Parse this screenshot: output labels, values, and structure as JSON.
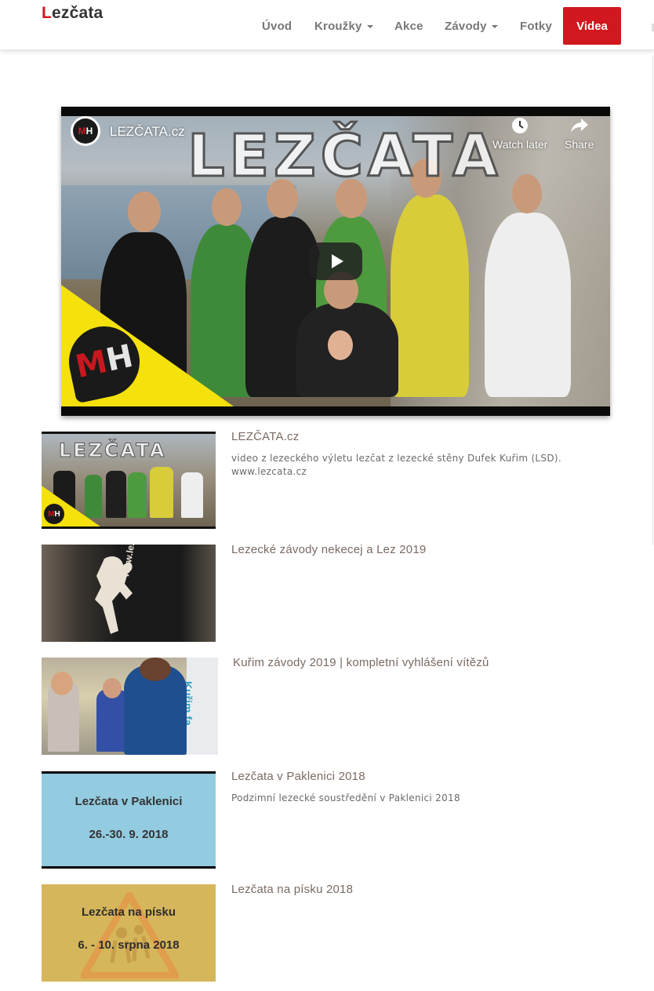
{
  "brand": {
    "first_letter": "L",
    "rest": "ezčata"
  },
  "nav": {
    "items": [
      "Úvod",
      "Kroužky",
      "Akce",
      "Závody",
      "Fotky"
    ],
    "active": "Videa"
  },
  "player": {
    "channel": "LEZČATA.cz",
    "overlay_title": "LEZČATA",
    "watch_later": "Watch later",
    "share": "Share",
    "logo_text": "MH"
  },
  "videos": [
    {
      "title": "LEZČATA.cz",
      "description_lines": [
        "video z lezeckého výletu lezčat z lezecké stěny Dufek Kuřim (LSD).",
        "www.lezcata.cz"
      ],
      "thumb_text": "LEZČATA"
    },
    {
      "title": "Lezecké závody nekecej a Lez 2019",
      "thumb_text": "www.lezcata.cz"
    },
    {
      "title": "Kuřim závody 2019 | kompletní vyhlášení vítězů",
      "thumb_text": "Kuřim fa"
    },
    {
      "title": "Lezčata v Paklenici 2018",
      "description_lines": [
        "Podzimní lezecké soustředění v Paklenici 2018"
      ],
      "thumb_lines": [
        "Lezčata v Paklenici",
        "26.-30. 9. 2018"
      ]
    },
    {
      "title": "Lezčata na písku 2018",
      "thumb_lines": [
        "Lezčata na písku",
        "6. - 10. srpna 2018"
      ]
    }
  ],
  "colors": {
    "accent": "#d0181e",
    "highlight_yellow": "#f5e10c",
    "title_text": "#7a6a62"
  }
}
